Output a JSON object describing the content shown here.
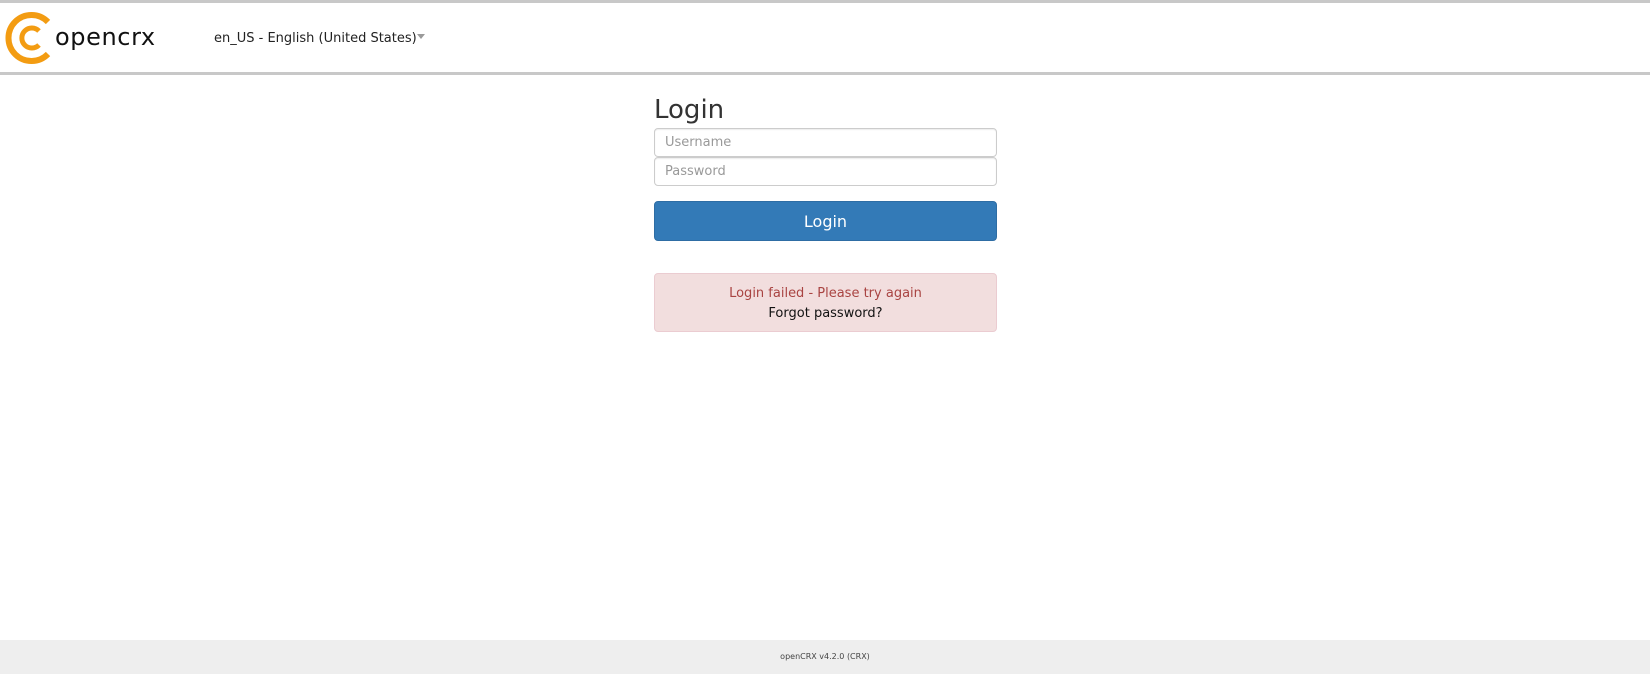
{
  "header": {
    "logo_text": "opencrx",
    "locale": "en_US - English (United States)",
    "icons": {
      "logo": "opencrx-logo-icon",
      "locale_caret": "chevron-down-icon"
    }
  },
  "login": {
    "title": "Login",
    "username": {
      "placeholder": "Username",
      "value": ""
    },
    "password": {
      "placeholder": "Password",
      "value": ""
    },
    "submit_label": "Login"
  },
  "alert": {
    "message": "Login failed - Please try again",
    "forgot_password": "Forgot password?"
  },
  "footer": {
    "version": "openCRX v4.2.0 (CRX)"
  },
  "colors": {
    "brand_orange": "#f39c12",
    "primary_button": "#337ab7",
    "alert_background": "#f2dede",
    "alert_text": "#a94442"
  }
}
